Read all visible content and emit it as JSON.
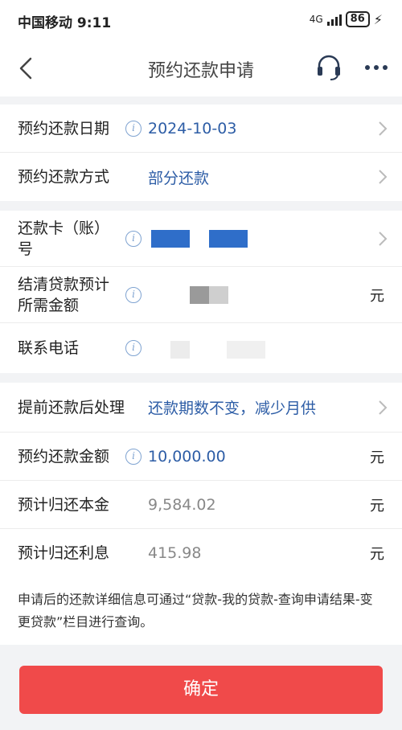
{
  "status_bar": {
    "carrier": "中国移动",
    "time": "9:11",
    "network": "4G",
    "battery": "86"
  },
  "nav": {
    "title": "预约还款申请"
  },
  "repayment": {
    "date_label": "预约还款日期",
    "date_value": "2024-10-03",
    "method_label": "预约还款方式",
    "method_value": "部分还款"
  },
  "account": {
    "card_label": "还款卡（账）号",
    "settle_label": "结清贷款预计所需金额",
    "settle_unit": "元",
    "phone_label": "联系电话"
  },
  "plan": {
    "after_label": "提前还款后处理",
    "after_value": "还款期数不变，减少月供",
    "amount_label": "预约还款金额",
    "amount_value": "10,000.00",
    "amount_unit": "元",
    "principal_label": "预计归还本金",
    "principal_value": "9,584.02",
    "principal_unit": "元",
    "interest_label": "预计归还利息",
    "interest_value": "415.98",
    "interest_unit": "元"
  },
  "notice": "申请后的还款详细信息可通过“贷款-我的贷款-查询申请结果-变更贷款”栏目进行查询。",
  "confirm_label": "确定",
  "colors": {
    "accent": "#2d5da6",
    "confirm": "#f04a4a",
    "mask_blue": "#2f6ec9"
  }
}
